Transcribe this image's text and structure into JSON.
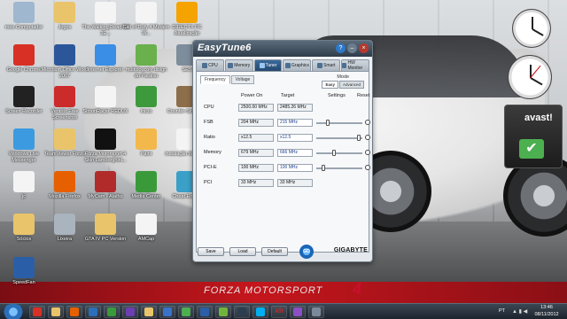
{
  "desktop": {
    "icons": [
      {
        "label": "meu Computador",
        "color": "#9fb7cf"
      },
      {
        "label": "Jogos",
        "color": "#e9c46a"
      },
      {
        "label": "The.Walking.Dead.S03E...",
        "color": "#f4f4f4"
      },
      {
        "label": "Call of Duty 4 Modern W...",
        "color": "#f4f4f4"
      },
      {
        "label": "DIRECTX PC Atualização",
        "color": "#f4a300"
      },
      {
        "label": "Google Chrome",
        "color": "#d93025"
      },
      {
        "label": "Microsoft Office Word 2007",
        "color": "#2b579a"
      },
      {
        "label": "Internet Explorer",
        "color": "#3a8ee6"
      },
      {
        "label": "muitoloucoly disign do Paraiso",
        "color": "#6ab04c"
      },
      {
        "label": "SES",
        "color": "#7d8d9c"
      },
      {
        "label": "Screen Recorder",
        "color": "#222"
      },
      {
        "label": "Ventrilo Free Screenshot",
        "color": "#cc2b2b"
      },
      {
        "label": "SimonRacer REDUX",
        "color": "#f4f4f4"
      },
      {
        "label": "Inicio",
        "color": "#3c9a3c"
      },
      {
        "label": "Counter-Strike 1.6",
        "color": "#8d6e4a"
      },
      {
        "label": "Windows Live Messenger",
        "color": "#3c9be0"
      },
      {
        "label": "TeamViewer Forza",
        "color": "#e9c46a"
      },
      {
        "label": "Forza Motorsport 4 Skin Lamborghini...",
        "color": "#111"
      },
      {
        "label": "Paint",
        "color": "#f2b84b"
      },
      {
        "label": "instalação do Atalho",
        "color": "#f4f4f4"
      },
      {
        "label": "jc",
        "color": "#f4f4f4"
      },
      {
        "label": "Mozilla Firefox",
        "color": "#e66000"
      },
      {
        "label": "MyCam - Atalho",
        "color": "#b22b2b"
      },
      {
        "label": "Media Center",
        "color": "#3a9a3a"
      },
      {
        "label": "Cheat Engine",
        "color": "#3aa0c8"
      },
      {
        "label": "Sócios",
        "color": "#e9c46a"
      },
      {
        "label": "Lixeira",
        "color": "#aab4be"
      },
      {
        "label": "GTA IV PC Version",
        "color": "#e9c46a"
      },
      {
        "label": "AMCap",
        "color": "#f4f4f4"
      },
      {
        "label": "SpeedFan",
        "color": "#2a5fa8"
      }
    ]
  },
  "wallpaper": {
    "brand": "FORZA MOTORSPORT",
    "brand_number": "4"
  },
  "gadgets": {
    "avast_label": "avast!",
    "check_glyph": "✔"
  },
  "easytune": {
    "title": "EasyTune6",
    "help_glyph": "?",
    "min_glyph": "–",
    "close_glyph": "×",
    "tabs": [
      {
        "label": "CPU",
        "active": false
      },
      {
        "label": "Memory",
        "active": false
      },
      {
        "label": "Tuner",
        "active": true
      },
      {
        "label": "Graphics",
        "active": false
      },
      {
        "label": "Smart",
        "active": false
      },
      {
        "label": "HW Monitor",
        "active": false
      }
    ],
    "subtabs": [
      "Frequency",
      "Voltage"
    ],
    "mode": {
      "label": "Mode",
      "easy": "Easy",
      "advanced": "Advanced"
    },
    "headers": {
      "power_on": "Power On",
      "target": "Target",
      "settings": "Settings",
      "reset": "Reset"
    },
    "rows": [
      {
        "label": "CPU",
        "power_on": "2500.00 MHz",
        "target": "2485.26 MHz",
        "editable": false,
        "slider": null
      },
      {
        "label": "FSB",
        "power_on": "204 MHz",
        "target": "215 MHz",
        "editable": true,
        "slider": 0.22
      },
      {
        "label": "Ratio",
        "power_on": "x12.5",
        "target": "x12.5",
        "editable": true,
        "slider": 0.95
      },
      {
        "label": "Memory",
        "power_on": "679 MHz",
        "target": "666 MHz",
        "editable": true,
        "slider": 0.38
      },
      {
        "label": "PCI-E",
        "power_on": "100 MHz",
        "target": "100 MHz",
        "editable": true,
        "slider": 0.12
      },
      {
        "label": "PCI",
        "power_on": "33 MHz",
        "target": "33 MHz",
        "editable": false,
        "slider": null
      }
    ],
    "buttons": {
      "save": "Save",
      "load": "Load",
      "default": "Default",
      "go": "GO"
    },
    "brand": "GIGABYTE"
  },
  "taskbar": {
    "apps": [
      {
        "name": "chrome",
        "color": "#d93025"
      },
      {
        "name": "explorer",
        "color": "#e9c46a"
      },
      {
        "name": "firefox",
        "color": "#e66000"
      },
      {
        "name": "media-player",
        "color": "#2b6fb8"
      },
      {
        "name": "photo-viewer",
        "color": "#3a9a3a"
      },
      {
        "name": "video",
        "color": "#6c3fb0"
      },
      {
        "name": "folder",
        "color": "#e9c46a"
      },
      {
        "name": "app-blue",
        "color": "#3a72c8"
      },
      {
        "name": "app-green",
        "color": "#4caf50"
      },
      {
        "name": "speedfan",
        "color": "#2a5fa8"
      },
      {
        "name": "utorrent",
        "color": "#71b43b"
      },
      {
        "name": "steam",
        "color": "#2c3e50"
      },
      {
        "name": "skype",
        "color": "#00aff0"
      },
      {
        "name": "ati",
        "color": "#e22222",
        "text": "ATI"
      },
      {
        "name": "app-purple",
        "color": "#8a4fc2"
      },
      {
        "name": "easytune",
        "color": "#7a8a9a"
      }
    ],
    "language": "PT",
    "tray": "▲ ▮ ◀",
    "time": "13:46",
    "date": "08/11/2012"
  }
}
